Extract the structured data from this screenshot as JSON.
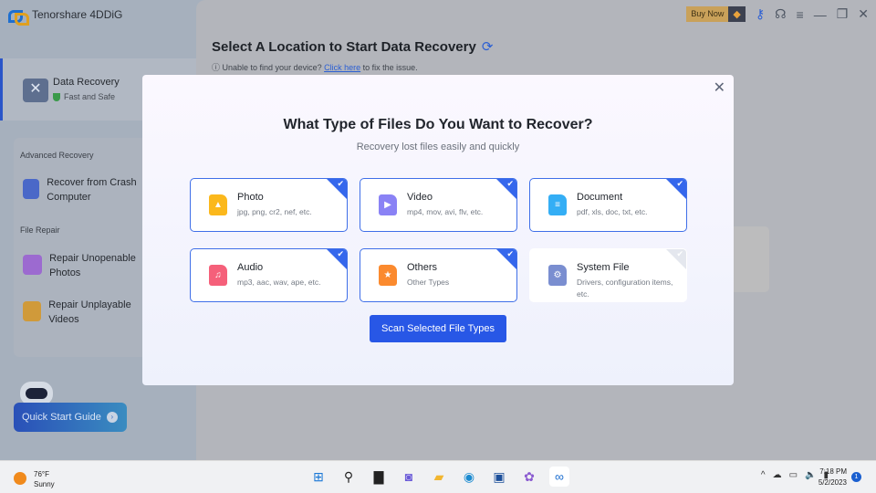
{
  "app": {
    "title": "Tenorshare 4DDiG",
    "buy_now": "Buy Now"
  },
  "sidebar": {
    "data_recovery": {
      "label": "Data Recovery",
      "sub": "Fast and Safe"
    },
    "advanced_title": "Advanced Recovery",
    "crash": "Recover from Crash Computer",
    "repair_title": "File Repair",
    "photos": "Repair Unopenable Photos",
    "videos": "Repair Unplayable Videos",
    "quick_start": "Quick Start Guide"
  },
  "main": {
    "title": "Select A Location to Start Data Recovery",
    "help_prefix": "Unable to find your device?",
    "help_link": "Click here",
    "help_suffix": "to fix the issue."
  },
  "modal": {
    "title": "What Type of Files Do You Want to Recover?",
    "subtitle": "Recovery lost files easily and quickly",
    "cards": [
      {
        "name": "Photo",
        "desc": "jpg, png, cr2, nef, etc.",
        "checked": true,
        "color": "#fbb81c"
      },
      {
        "name": "Video",
        "desc": "mp4, mov, avi, flv, etc.",
        "checked": true,
        "color": "#8a82f5"
      },
      {
        "name": "Document",
        "desc": "pdf, xls, doc, txt, etc.",
        "checked": true,
        "color": "#34aef5"
      },
      {
        "name": "Audio",
        "desc": "mp3, aac, wav, ape, etc.",
        "checked": true,
        "color": "#f5607a"
      },
      {
        "name": "Others",
        "desc": "Other Types",
        "checked": true,
        "color": "#fb8a2e"
      },
      {
        "name": "System File",
        "desc": "Drivers, configuration items, etc.",
        "checked": false,
        "color": "#7a8ed0"
      }
    ],
    "scan_button": "Scan Selected File Types"
  },
  "taskbar": {
    "temp": "76°F",
    "weather": "Sunny",
    "time": "7:18 PM",
    "date": "5/2/2023",
    "notifications": "1"
  }
}
